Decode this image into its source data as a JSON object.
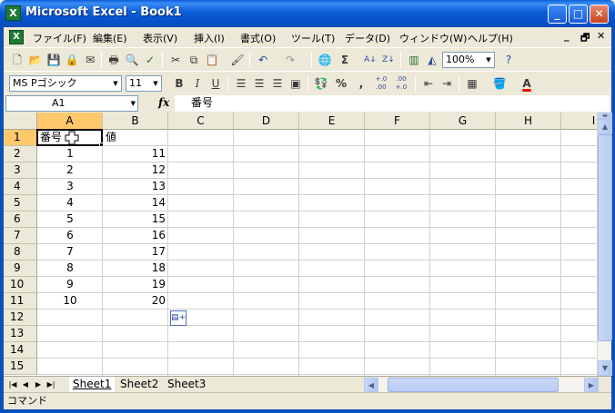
{
  "window": {
    "app_icon": "X",
    "title": "Microsoft Excel - Book1",
    "min_label": "_",
    "max_label": "□",
    "close_label": "✕"
  },
  "menu": {
    "items": [
      "ファイル(F)",
      "編集(E)",
      "表示(V)",
      "挿入(I)",
      "書式(O)",
      "ツール(T)",
      "データ(D)",
      "ウィンドウ(W)",
      "ヘルプ(H)"
    ],
    "doc_min": "_",
    "doc_restore": "🗗",
    "doc_close": "✕"
  },
  "toolbar": {
    "zoom": "100%",
    "font_name": "MS Pゴシック",
    "font_size": "11",
    "bold": "B",
    "italic": "I",
    "underline": "U",
    "percent": "%",
    "comma": ",",
    "inc_decimal": "+.0 .00",
    "dec_decimal": ".00 +.0",
    "sigma": "Σ",
    "font_color_letter": "A"
  },
  "formula_bar": {
    "name_box": "A1",
    "fx": "fx",
    "content": "番号"
  },
  "grid": {
    "columns": [
      "A",
      "B",
      "C",
      "D",
      "E",
      "F",
      "G",
      "H",
      "I"
    ],
    "rows": [
      "1",
      "2",
      "3",
      "4",
      "5",
      "6",
      "7",
      "8",
      "9",
      "10",
      "11",
      "12",
      "13",
      "14",
      "15"
    ],
    "header_row": [
      "番号",
      "値"
    ],
    "data": [
      [
        "1",
        "11"
      ],
      [
        "2",
        "12"
      ],
      [
        "3",
        "13"
      ],
      [
        "4",
        "14"
      ],
      [
        "5",
        "15"
      ],
      [
        "6",
        "16"
      ],
      [
        "7",
        "17"
      ],
      [
        "8",
        "18"
      ],
      [
        "9",
        "19"
      ],
      [
        "10",
        "20"
      ]
    ]
  },
  "sheets": {
    "tabs": [
      "Sheet1",
      "Sheet2",
      "Sheet3"
    ],
    "active": "Sheet1"
  },
  "status": {
    "text": "コマンド"
  }
}
